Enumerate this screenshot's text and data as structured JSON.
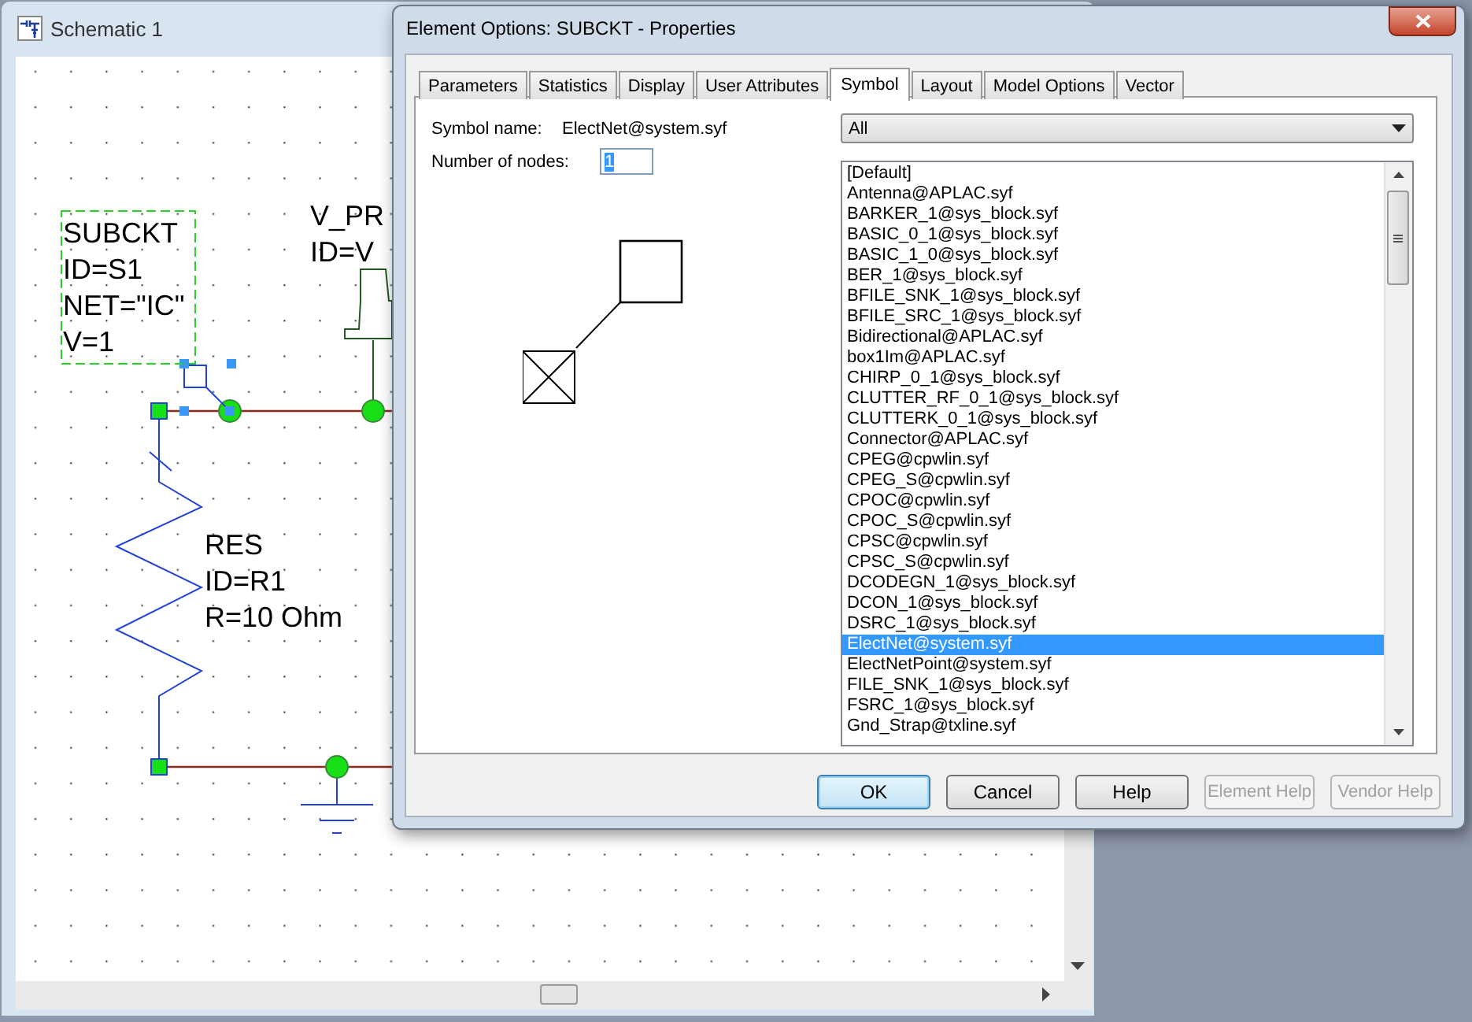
{
  "schematic": {
    "title": "Schematic 1",
    "labels": [
      {
        "lines": [
          "SUBCKT",
          "ID=S1",
          "NET=\"IC\"",
          "V=1"
        ],
        "selected": true
      },
      {
        "lines": [
          "V_PR",
          "ID=V"
        ],
        "selected": false
      },
      {
        "lines": [
          "RES",
          "ID=R1",
          "R=10 Ohm"
        ],
        "selected": false
      }
    ]
  },
  "dialog": {
    "title": "Element Options: SUBCKT -  Properties",
    "tabs": [
      {
        "label": "Parameters",
        "selected": false
      },
      {
        "label": "Statistics",
        "selected": false
      },
      {
        "label": "Display",
        "selected": false
      },
      {
        "label": "User Attributes",
        "selected": false
      },
      {
        "label": "Symbol",
        "selected": true
      },
      {
        "label": "Layout",
        "selected": false
      },
      {
        "label": "Model Options",
        "selected": false
      },
      {
        "label": "Vector",
        "selected": false
      }
    ],
    "symbol_name_label": "Symbol name:",
    "symbol_name": "ElectNet@system.syf",
    "nodes_label": "Number of nodes:",
    "nodes_value": "1",
    "filter": "All",
    "symbols": [
      {
        "label": "[Default]",
        "selected": false
      },
      {
        "label": "Antenna@APLAC.syf",
        "selected": false
      },
      {
        "label": "BARKER_1@sys_block.syf",
        "selected": false
      },
      {
        "label": "BASIC_0_1@sys_block.syf",
        "selected": false
      },
      {
        "label": "BASIC_1_0@sys_block.syf",
        "selected": false
      },
      {
        "label": "BER_1@sys_block.syf",
        "selected": false
      },
      {
        "label": "BFILE_SNK_1@sys_block.syf",
        "selected": false
      },
      {
        "label": "BFILE_SRC_1@sys_block.syf",
        "selected": false
      },
      {
        "label": "Bidirectional@APLAC.syf",
        "selected": false
      },
      {
        "label": "box1Im@APLAC.syf",
        "selected": false
      },
      {
        "label": "CHIRP_0_1@sys_block.syf",
        "selected": false
      },
      {
        "label": "CLUTTER_RF_0_1@sys_block.syf",
        "selected": false
      },
      {
        "label": "CLUTTERK_0_1@sys_block.syf",
        "selected": false
      },
      {
        "label": "Connector@APLAC.syf",
        "selected": false
      },
      {
        "label": "CPEG@cpwlin.syf",
        "selected": false
      },
      {
        "label": "CPEG_S@cpwlin.syf",
        "selected": false
      },
      {
        "label": "CPOC@cpwlin.syf",
        "selected": false
      },
      {
        "label": "CPOC_S@cpwlin.syf",
        "selected": false
      },
      {
        "label": "CPSC@cpwlin.syf",
        "selected": false
      },
      {
        "label": "CPSC_S@cpwlin.syf",
        "selected": false
      },
      {
        "label": "DCODEGN_1@sys_block.syf",
        "selected": false
      },
      {
        "label": "DCON_1@sys_block.syf",
        "selected": false
      },
      {
        "label": "DSRC_1@sys_block.syf",
        "selected": false
      },
      {
        "label": "ElectNet@system.syf",
        "selected": true
      },
      {
        "label": "ElectNetPoint@system.syf",
        "selected": false
      },
      {
        "label": "FILE_SNK_1@sys_block.syf",
        "selected": false
      },
      {
        "label": "FSRC_1@sys_block.syf",
        "selected": false
      },
      {
        "label": "Gnd_Strap@txline.syf",
        "selected": false
      }
    ],
    "buttons": [
      {
        "label": "OK",
        "default": true,
        "disabled": false
      },
      {
        "label": "Cancel",
        "default": false,
        "disabled": false
      },
      {
        "label": "Help",
        "default": false,
        "disabled": false
      },
      {
        "label": "Element Help",
        "default": false,
        "disabled": true
      },
      {
        "label": "Vendor Help",
        "default": false,
        "disabled": true
      }
    ]
  }
}
